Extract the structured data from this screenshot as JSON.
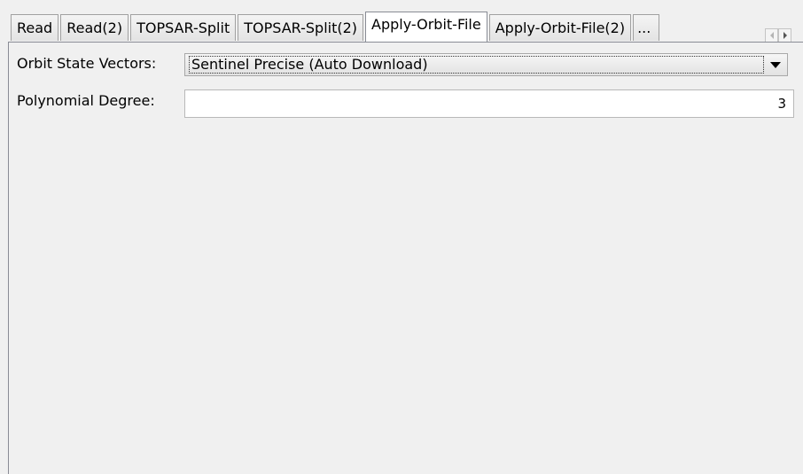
{
  "tabs": [
    {
      "label": "Read",
      "selected": false
    },
    {
      "label": "Read(2)",
      "selected": false
    },
    {
      "label": "TOPSAR-Split",
      "selected": false
    },
    {
      "label": "TOPSAR-Split(2)",
      "selected": false
    },
    {
      "label": "Apply-Orbit-File",
      "selected": true
    },
    {
      "label": "Apply-Orbit-File(2)",
      "selected": false
    },
    {
      "label": "...",
      "selected": false
    }
  ],
  "tab_scroll": {
    "left_icon": "arrow-left-icon",
    "right_icon": "arrow-right-icon"
  },
  "form": {
    "orbit_label": "Orbit State Vectors:",
    "orbit_value": "Sentinel Precise (Auto Download)",
    "poly_label": "Polynomial Degree:",
    "poly_value": "3"
  },
  "colors": {
    "background": "#f0f0f0",
    "field_background": "#ffffff",
    "border": "#898c95"
  }
}
